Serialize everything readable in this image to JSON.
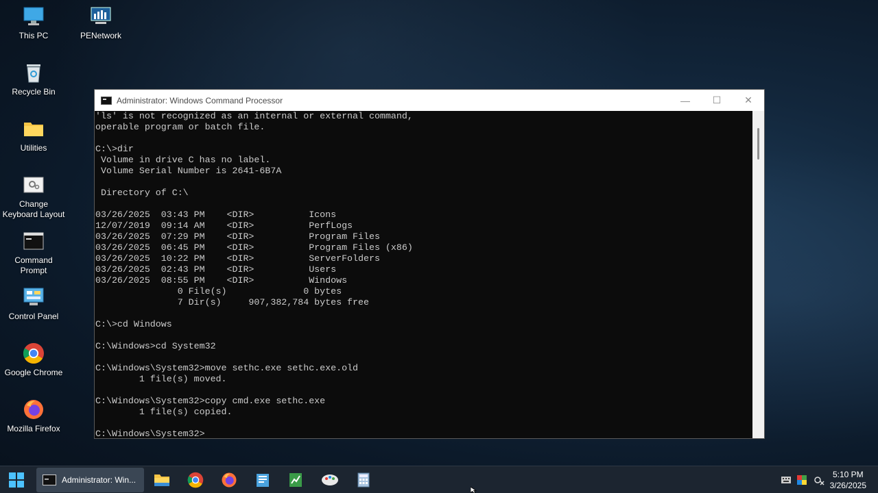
{
  "desktop": {
    "icons": [
      {
        "label": "This PC",
        "icon": "monitor-icon"
      },
      {
        "label": "PENetwork",
        "icon": "network-icon"
      },
      {
        "label": "Recycle Bin",
        "icon": "recycle-bin-icon"
      },
      {
        "label": "Utilities",
        "icon": "folder-icon"
      },
      {
        "label": "Change Keyboard Layout",
        "icon": "keyboard-settings-icon"
      },
      {
        "label": "Command Prompt",
        "icon": "command-prompt-icon"
      },
      {
        "label": "Control Panel",
        "icon": "control-panel-icon"
      },
      {
        "label": "Google Chrome",
        "icon": "chrome-icon"
      },
      {
        "label": "Mozilla Firefox",
        "icon": "firefox-icon"
      }
    ]
  },
  "window": {
    "title": "Administrator: Windows Command Processor",
    "minimize": "—",
    "maximize": "☐",
    "close": "✕"
  },
  "console": {
    "lines": [
      "'ls' is not recognized as an internal or external command,",
      "operable program or batch file.",
      "",
      "C:\\>dir",
      " Volume in drive C has no label.",
      " Volume Serial Number is 2641-6B7A",
      "",
      " Directory of C:\\",
      "",
      "03/26/2025  03:43 PM    <DIR>          Icons",
      "12/07/2019  09:14 AM    <DIR>          PerfLogs",
      "03/26/2025  07:29 PM    <DIR>          Program Files",
      "03/26/2025  06:45 PM    <DIR>          Program Files (x86)",
      "03/26/2025  10:22 PM    <DIR>          ServerFolders",
      "03/26/2025  02:43 PM    <DIR>          Users",
      "03/26/2025  08:55 PM    <DIR>          Windows",
      "               0 File(s)              0 bytes",
      "               7 Dir(s)     907,382,784 bytes free",
      "",
      "C:\\>cd Windows",
      "",
      "C:\\Windows>cd System32",
      "",
      "C:\\Windows\\System32>move sethc.exe sethc.exe.old",
      "        1 file(s) moved.",
      "",
      "C:\\Windows\\System32>copy cmd.exe sethc.exe",
      "        1 file(s) copied.",
      "",
      "C:\\Windows\\System32>"
    ]
  },
  "taskbar": {
    "active_window_label": "Administrator: Win...",
    "pinned": [
      "start-icon",
      "file-explorer-icon",
      "chrome-icon",
      "firefox-icon",
      "notepad-icon",
      "spreadsheet-icon",
      "paint-icon",
      "calculator-icon"
    ],
    "time": "5:10 PM",
    "date": "3/26/2025"
  }
}
